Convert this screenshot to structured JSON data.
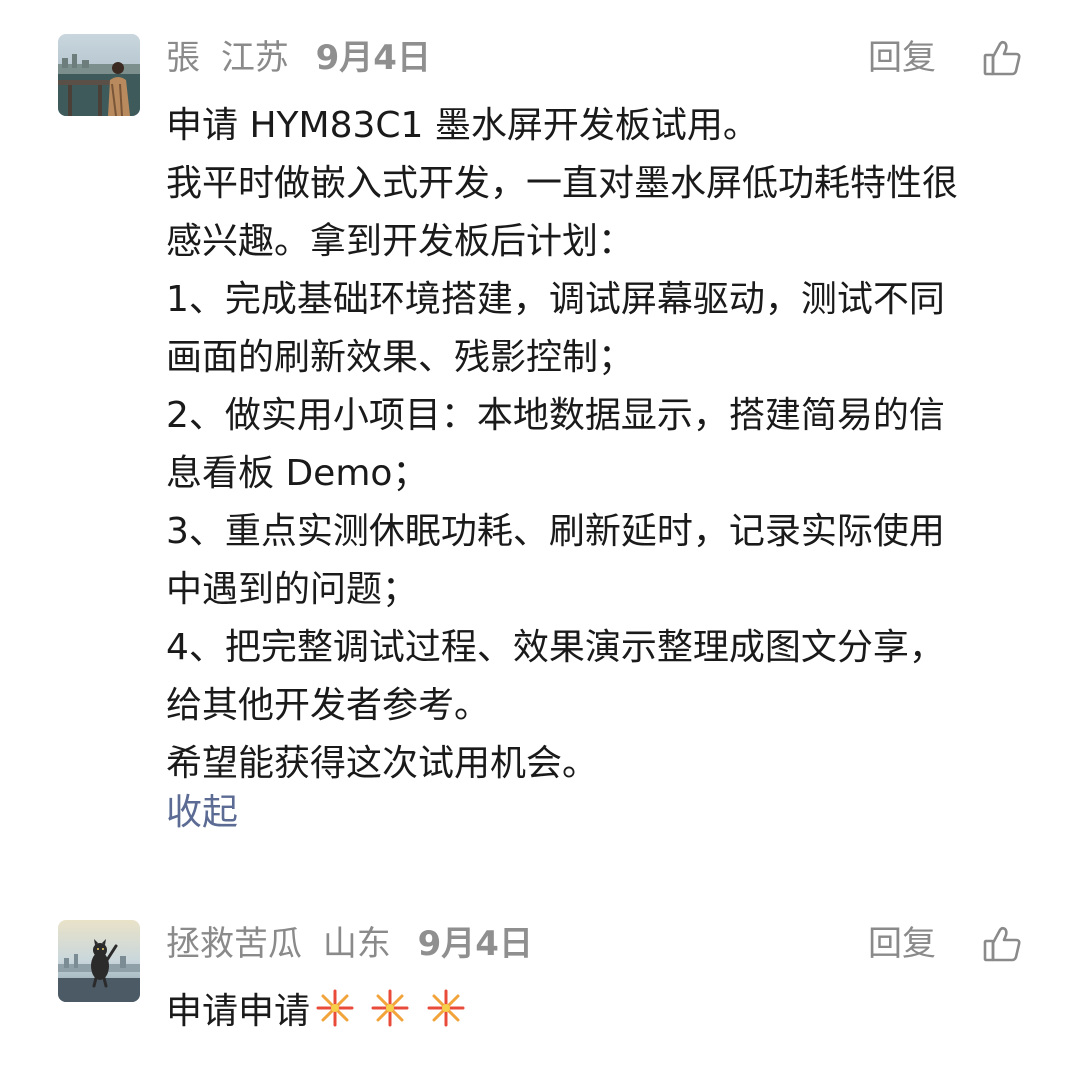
{
  "comments": [
    {
      "author": "張",
      "location": "江苏",
      "date": "9月4日",
      "reply_label": "回复",
      "lines": [
        "申请 HYM83C1 墨水屏开发板试用。",
        "我平时做嵌入式开发，一直对墨水屏低功耗特性很",
        "感兴趣。拿到开发板后计划：",
        "1、完成基础环境搭建，调试屏幕驱动，测试不同",
        "画面的刷新效果、残影控制；",
        "2、做实用小项目：本地数据显示，搭建简易的信",
        "息看板 Demo；",
        "3、重点实测休眠功耗、刷新延时，记录实际使用",
        "中遇到的问题；",
        "4、把完整调试过程、效果演示整理成图文分享，",
        "给其他开发者参考。",
        "希望能获得这次试用机会。"
      ],
      "collapse_label": "收起"
    },
    {
      "author": "拯救苦瓜",
      "location": "山东",
      "date": "9月4日",
      "reply_label": "回复",
      "text": "申请申请",
      "emoji": "fireworks-icon"
    }
  ],
  "colors": {
    "meta": "#8a8a8a",
    "text": "#1a1a1a",
    "link": "#5b6b93"
  }
}
